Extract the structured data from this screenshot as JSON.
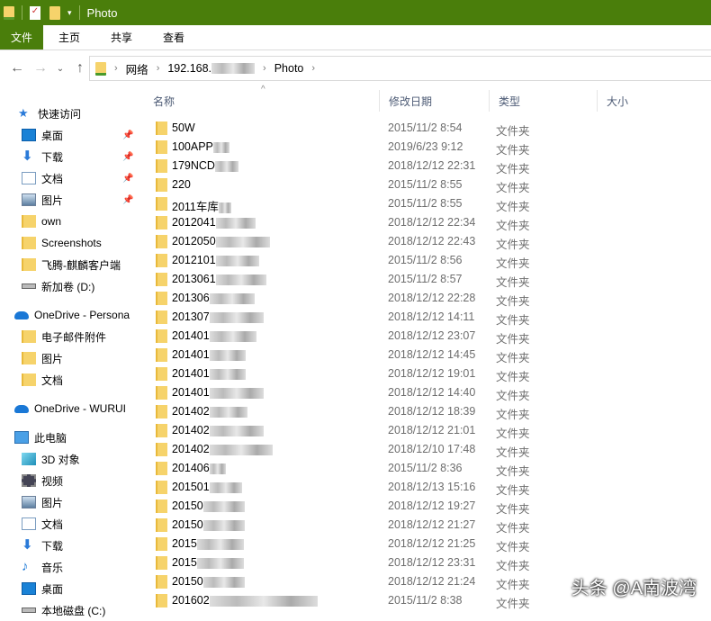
{
  "window": {
    "title": "Photo"
  },
  "ribbon": {
    "tabs": [
      "文件",
      "主页",
      "共享",
      "查看"
    ]
  },
  "address": {
    "crumbs": [
      "网络",
      "192.168.",
      "Photo"
    ]
  },
  "columns": {
    "name": "名称",
    "date": "修改日期",
    "type": "类型",
    "size": "大小"
  },
  "sidebar": [
    {
      "label": "快速访问",
      "icon": "star-icon",
      "level": 0
    },
    {
      "label": "桌面",
      "icon": "desktop-icon",
      "level": 1,
      "pinned": true
    },
    {
      "label": "下载",
      "icon": "download-icon",
      "level": 1,
      "pinned": true
    },
    {
      "label": "文档",
      "icon": "document-icon",
      "level": 1,
      "pinned": true
    },
    {
      "label": "图片",
      "icon": "pictures-icon",
      "level": 1,
      "pinned": true
    },
    {
      "label": "own",
      "icon": "folder-icon",
      "level": 1
    },
    {
      "label": "Screenshots",
      "icon": "folder-icon",
      "level": 1
    },
    {
      "label": "飞腾-麒麟客户端",
      "icon": "folder-icon",
      "level": 1
    },
    {
      "label": "新加卷 (D:)",
      "icon": "drive-icon",
      "level": 1
    },
    {
      "label": "OneDrive - Persona",
      "icon": "cloud-icon",
      "level": 0,
      "gap": true
    },
    {
      "label": "电子邮件附件",
      "icon": "folder-icon",
      "level": 1
    },
    {
      "label": "图片",
      "icon": "folder-icon",
      "level": 1
    },
    {
      "label": "文档",
      "icon": "folder-icon",
      "level": 1
    },
    {
      "label": "OneDrive - WURUI",
      "icon": "cloud-icon",
      "level": 0,
      "gap": true
    },
    {
      "label": "此电脑",
      "icon": "computer-icon",
      "level": 0,
      "gap": true
    },
    {
      "label": "3D 对象",
      "icon": "cube-icon",
      "level": 1
    },
    {
      "label": "视频",
      "icon": "video-icon",
      "level": 1
    },
    {
      "label": "图片",
      "icon": "pictures-icon",
      "level": 1
    },
    {
      "label": "文档",
      "icon": "document-icon",
      "level": 1
    },
    {
      "label": "下载",
      "icon": "download-icon",
      "level": 1
    },
    {
      "label": "音乐",
      "icon": "music-icon",
      "level": 1
    },
    {
      "label": "桌面",
      "icon": "desktop-icon",
      "level": 1
    },
    {
      "label": "本地磁盘 (C:)",
      "icon": "drive-icon",
      "level": 1
    }
  ],
  "files": [
    {
      "name": "50W",
      "date": "2015/11/2 8:54",
      "type": "文件夹"
    },
    {
      "name": "100APP",
      "date": "2019/6/23 9:12",
      "type": "文件夹"
    },
    {
      "name": "179NCD",
      "date": "2018/12/12 22:31",
      "type": "文件夹"
    },
    {
      "name": "220",
      "date": "2015/11/2 8:55",
      "type": "文件夹"
    },
    {
      "name": "2011车库",
      "date": "2015/11/2 8:55",
      "type": "文件夹"
    },
    {
      "name": "2012041",
      "date": "2018/12/12 22:34",
      "type": "文件夹"
    },
    {
      "name": "2012050",
      "date": "2018/12/12 22:43",
      "type": "文件夹"
    },
    {
      "name": "2012101",
      "date": "2015/11/2 8:56",
      "type": "文件夹"
    },
    {
      "name": "2013061",
      "date": "2015/11/2 8:57",
      "type": "文件夹"
    },
    {
      "name": "201306",
      "date": "2018/12/12 22:28",
      "type": "文件夹"
    },
    {
      "name": "201307",
      "date": "2018/12/12 14:11",
      "type": "文件夹"
    },
    {
      "name": "201401",
      "date": "2018/12/12 23:07",
      "type": "文件夹"
    },
    {
      "name": "201401",
      "date": "2018/12/12 14:45",
      "type": "文件夹"
    },
    {
      "name": "201401",
      "date": "2018/12/12 19:01",
      "type": "文件夹"
    },
    {
      "name": "201401",
      "date": "2018/12/12 14:40",
      "type": "文件夹"
    },
    {
      "name": "201402",
      "date": "2018/12/12 18:39",
      "type": "文件夹"
    },
    {
      "name": "201402",
      "date": "2018/12/12 21:01",
      "type": "文件夹"
    },
    {
      "name": "201402",
      "date": "2018/12/10 17:48",
      "type": "文件夹"
    },
    {
      "name": "201406",
      "date": "2015/11/2 8:36",
      "type": "文件夹"
    },
    {
      "name": "201501",
      "date": "2018/12/13 15:16",
      "type": "文件夹"
    },
    {
      "name": "20150",
      "date": "2018/12/12 19:27",
      "type": "文件夹"
    },
    {
      "name": "20150",
      "date": "2018/12/12 21:27",
      "type": "文件夹"
    },
    {
      "name": "2015",
      "date": "2018/12/12 21:25",
      "type": "文件夹"
    },
    {
      "name": "2015",
      "date": "2018/12/12 23:31",
      "type": "文件夹"
    },
    {
      "name": "20150",
      "date": "2018/12/12 21:24",
      "type": "文件夹"
    },
    {
      "name": "201602",
      "date": "2015/11/2 8:38",
      "type": "文件夹"
    }
  ],
  "watermark": "头条 @A南波湾",
  "colors": {
    "titlebar": "#4a7e0b",
    "folder": "#f6d36b"
  }
}
